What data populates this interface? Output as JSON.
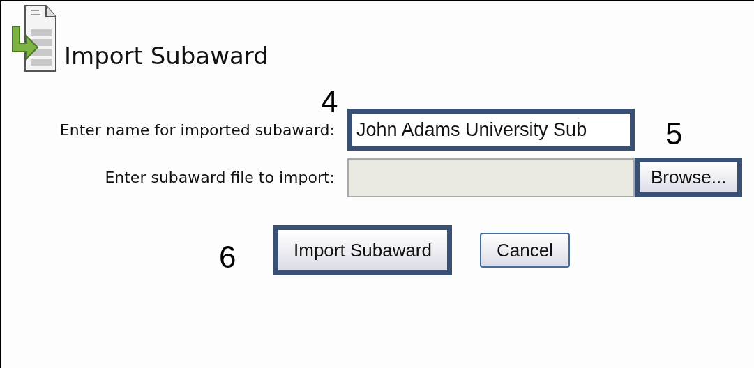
{
  "title": "Import Subaward",
  "fields": [
    {
      "kind": "text",
      "label": "Enter name for imported subaward:",
      "value": "John Adams University Sub",
      "highlighted": true
    },
    {
      "kind": "file",
      "label": "Enter subaward file to import:",
      "button": "Browse...",
      "highlighted": false,
      "button_highlighted": true
    }
  ],
  "buttons": [
    {
      "label": "Import Subaward",
      "highlighted": true
    },
    {
      "label": "Cancel",
      "highlighted": false
    }
  ],
  "callouts": [
    "4",
    "5",
    "6"
  ]
}
